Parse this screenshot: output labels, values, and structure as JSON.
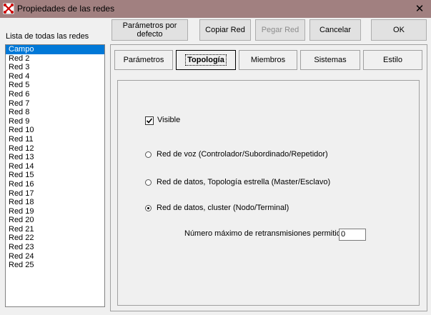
{
  "window": {
    "title": "Propiedades de las redes",
    "close": "✕"
  },
  "list": {
    "caption": "Lista de todas las redes",
    "items": [
      "Campo",
      "Red  2",
      "Red  3",
      "Red  4",
      "Red  5",
      "Red  6",
      "Red  7",
      "Red  8",
      "Red  9",
      "Red 10",
      "Red 11",
      "Red 12",
      "Red 13",
      "Red 14",
      "Red 15",
      "Red 16",
      "Red 17",
      "Red 18",
      "Red 19",
      "Red 20",
      "Red 21",
      "Red 22",
      "Red 23",
      "Red 24",
      "Red 25"
    ],
    "selected": "Campo"
  },
  "toolbar": {
    "defaults": "Parámetros por defecto",
    "copy": "Copiar Red",
    "paste": "Pegar Red",
    "cancel": "Cancelar",
    "ok": "OK"
  },
  "tabs": [
    "Parámetros",
    "Topología",
    "Miembros",
    "Sistemas",
    "Estilo"
  ],
  "active_tab": "Topología",
  "topology": {
    "visible_label": "Visible",
    "visible_checked": true,
    "options": [
      {
        "label": "Red de voz (Controlador/Subordinado/Repetidor)",
        "selected": false
      },
      {
        "label": "Red de datos, Topología estrella (Master/Esclavo)",
        "selected": false
      },
      {
        "label": "Red de datos, cluster (Nodo/Terminal)",
        "selected": true
      }
    ],
    "retrans_label": "Número máximo de retransmisiones permitidas",
    "retrans_value": "0"
  }
}
